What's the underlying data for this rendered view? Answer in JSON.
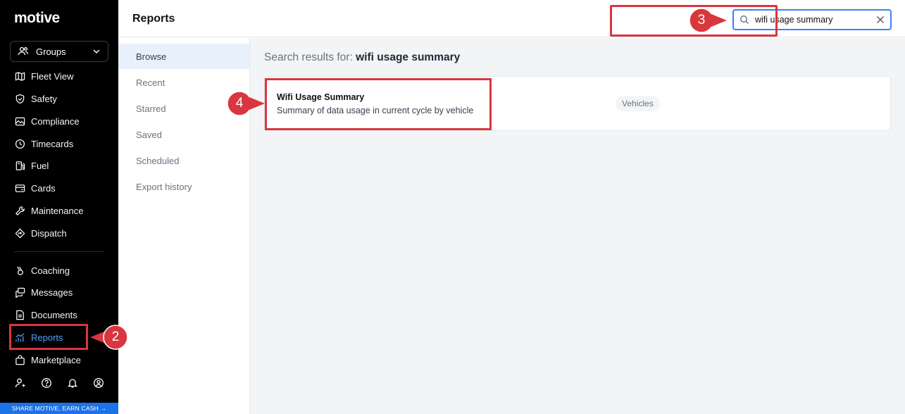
{
  "sidebar": {
    "logo": "motive",
    "groups_label": "Groups",
    "items_top": [
      {
        "label": "Fleet View",
        "icon": "map-icon"
      },
      {
        "label": "Safety",
        "icon": "shield-icon"
      },
      {
        "label": "Compliance",
        "icon": "image-icon"
      },
      {
        "label": "Timecards",
        "icon": "clock-icon"
      },
      {
        "label": "Fuel",
        "icon": "fuel-icon"
      },
      {
        "label": "Cards",
        "icon": "card-icon"
      },
      {
        "label": "Maintenance",
        "icon": "wrench-icon"
      },
      {
        "label": "Dispatch",
        "icon": "pin-icon"
      }
    ],
    "items_bottom": [
      {
        "label": "Coaching",
        "icon": "whistle-icon"
      },
      {
        "label": "Messages",
        "icon": "chat-icon"
      },
      {
        "label": "Documents",
        "icon": "document-icon"
      },
      {
        "label": "Reports",
        "icon": "chart-icon"
      },
      {
        "label": "Marketplace",
        "icon": "bag-icon"
      }
    ],
    "share_text": "SHARE MOTIVE, EARN CASH →",
    "active_color": "#4ea3ff"
  },
  "header": {
    "title": "Reports",
    "search_value": "wifi usage summary"
  },
  "subnav": {
    "items": [
      "Browse",
      "Recent",
      "Starred",
      "Saved",
      "Scheduled",
      "Export history"
    ],
    "active": "Browse"
  },
  "main": {
    "results_prefix": "Search results for:",
    "results_query": "wifi usage summary",
    "result": {
      "name": "Wifi Usage Summary",
      "description": "Summary of data usage in current cycle by vehicle",
      "tag": "Vehicles"
    }
  },
  "callouts": {
    "step_reports": "2",
    "step_search": "3",
    "step_result": "4",
    "color": "#d9363e"
  }
}
